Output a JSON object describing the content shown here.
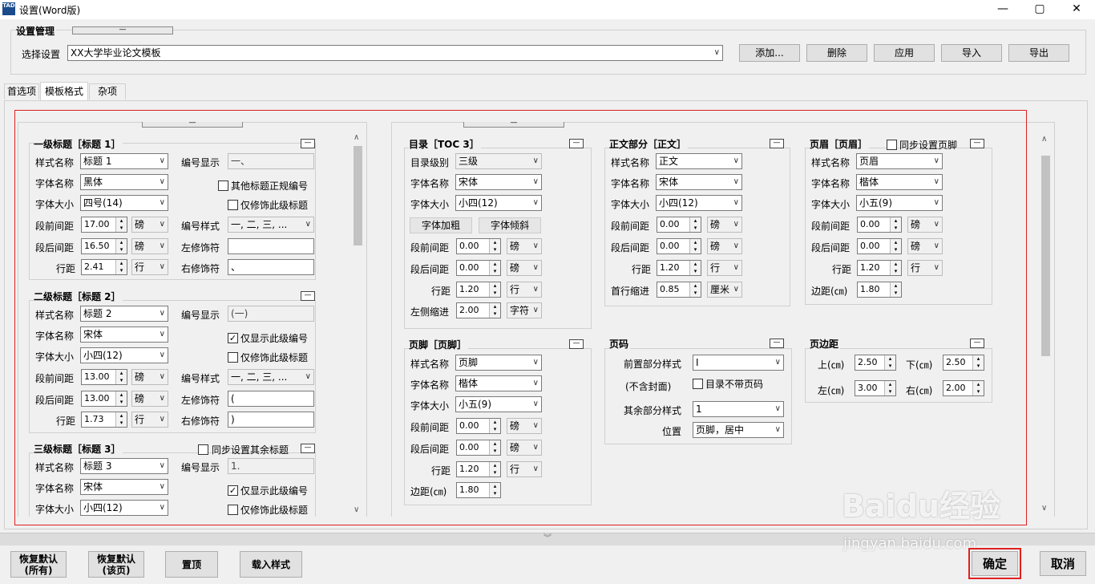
{
  "window": {
    "title": "设置(Word版)",
    "icon_text": "TAD",
    "min": "—",
    "max": "▢",
    "close": "✕"
  },
  "mgmt": {
    "title": "设置管理",
    "select_label": "选择设置",
    "selected": "XX大学毕业论文模板",
    "buttons": [
      "添加...",
      "删除",
      "应用",
      "导入",
      "导出"
    ]
  },
  "tabs": [
    "首选项",
    "模板格式",
    "杂项"
  ],
  "h1": {
    "title": "一级标题［标题 1］",
    "style_label": "样式名称",
    "style": "标题 1",
    "font_label": "字体名称",
    "font": "黑体",
    "size_label": "字体大小",
    "size": "四号(14)",
    "before_label": "段前间距",
    "before": "17.00",
    "before_unit": "磅",
    "after_label": "段后间距",
    "after": "16.50",
    "after_unit": "磅",
    "line_label": "行距",
    "line": "2.41",
    "line_unit": "行",
    "num_label": "编号显示",
    "num": "一、",
    "cb1": "其他标题正规编号",
    "cb2": "仅修饰此级标题",
    "numstyle_label": "编号样式",
    "numstyle": "一, 二, 三, ...",
    "left_label": "左修饰符",
    "left": "",
    "right_label": "右修饰符",
    "right": "、"
  },
  "h2": {
    "title": "二级标题［标题 2］",
    "style_label": "样式名称",
    "style": "标题 2",
    "font_label": "字体名称",
    "font": "宋体",
    "size_label": "字体大小",
    "size": "小四(12)",
    "before_label": "段前间距",
    "before": "13.00",
    "before_unit": "磅",
    "after_label": "段后间距",
    "after": "13.00",
    "after_unit": "磅",
    "line_label": "行距",
    "line": "1.73",
    "line_unit": "行",
    "num_label": "编号显示",
    "num": "(一)",
    "cb1": "仅显示此级编号",
    "cb2": "仅修饰此级标题",
    "numstyle_label": "编号样式",
    "numstyle": "一, 二, 三, ...",
    "left_label": "左修饰符",
    "left": "(",
    "right_label": "右修饰符",
    "right": ")"
  },
  "h3": {
    "title": "三级标题［标题 3］",
    "sync": "同步设置其余标题",
    "style_label": "样式名称",
    "style": "标题 3",
    "font_label": "字体名称",
    "font": "宋体",
    "size_label": "字体大小",
    "size": "小四(12)",
    "num_label": "编号显示",
    "num": "1.",
    "cb1": "仅显示此级编号",
    "cb2": "仅修饰此级标题"
  },
  "toc": {
    "title": "目录［TOC 3］",
    "level_label": "目录级别",
    "level": "三级",
    "font_label": "字体名称",
    "font": "宋体",
    "size_label": "字体大小",
    "size": "小四(12)",
    "bold": "字体加粗",
    "italic": "字体倾斜",
    "before_label": "段前间距",
    "before": "0.00",
    "before_unit": "磅",
    "after_label": "段后间距",
    "after": "0.00",
    "after_unit": "磅",
    "line_label": "行距",
    "line": "1.20",
    "line_unit": "行",
    "indent_label": "左侧缩进",
    "indent": "2.00",
    "indent_unit": "字符"
  },
  "body": {
    "title": "正文部分［正文］",
    "style_label": "样式名称",
    "style": "正文",
    "font_label": "字体名称",
    "font": "宋体",
    "size_label": "字体大小",
    "size": "小四(12)",
    "before_label": "段前间距",
    "before": "0.00",
    "before_unit": "磅",
    "after_label": "段后间距",
    "after": "0.00",
    "after_unit": "磅",
    "line_label": "行距",
    "line": "1.20",
    "line_unit": "行",
    "indent_label": "首行缩进",
    "indent": "0.85",
    "indent_unit": "厘米"
  },
  "header": {
    "title": "页眉［页眉］",
    "sync": "同步设置页脚",
    "style_label": "样式名称",
    "style": "页眉",
    "font_label": "字体名称",
    "font": "楷体",
    "size_label": "字体大小",
    "size": "小五(9)",
    "before_label": "段前间距",
    "before": "0.00",
    "before_unit": "磅",
    "after_label": "段后间距",
    "after": "0.00",
    "after_unit": "磅",
    "line_label": "行距",
    "line": "1.20",
    "line_unit": "行",
    "margin_label": "边距(㎝)",
    "margin": "1.80"
  },
  "footer": {
    "title": "页脚［页脚］",
    "style_label": "样式名称",
    "style": "页脚",
    "font_label": "字体名称",
    "font": "楷体",
    "size_label": "字体大小",
    "size": "小五(9)",
    "before_label": "段前间距",
    "before": "0.00",
    "before_unit": "磅",
    "after_label": "段后间距",
    "after": "0.00",
    "after_unit": "磅",
    "line_label": "行距",
    "line": "1.20",
    "line_unit": "行",
    "margin_label": "边距(㎝)",
    "margin": "1.80"
  },
  "pagenum": {
    "title": "页码",
    "front_label": "前置部分样式",
    "front": "I",
    "nocover": "(不含封面)",
    "toc_cb": "目录不带页码",
    "rest_label": "其余部分样式",
    "rest": "1",
    "pos_label": "位置",
    "pos": "页脚，居中"
  },
  "margins": {
    "title": "页边距",
    "top_label": "上(㎝)",
    "top": "2.50",
    "bottom_label": "下(㎝)",
    "bottom": "2.50",
    "left_label": "左(㎝)",
    "left": "3.00",
    "right_label": "右(㎝)",
    "right": "2.00"
  },
  "footer_btns": {
    "restore_all": [
      "恢复默认",
      "(所有)"
    ],
    "restore_page": [
      "恢复默认",
      "(该页)"
    ],
    "top": "置顶",
    "load": "载入样式",
    "ok": "确定",
    "cancel": "取消"
  },
  "watermark": {
    "brand": "Baidu经验",
    "url": "jingyan.baidu.com"
  }
}
